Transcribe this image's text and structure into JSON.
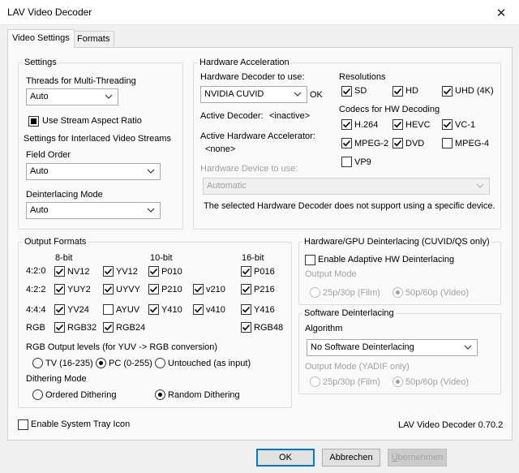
{
  "window": {
    "title": "LAV Video Decoder",
    "close_glyph": "✕"
  },
  "tabs": [
    {
      "label": "Video Settings"
    },
    {
      "label": "Formats"
    }
  ],
  "settings": {
    "legend": "Settings",
    "threads_label": "Threads for Multi-Threading",
    "threads_value": "Auto",
    "stream_aspect_label": "Use Stream Aspect Ratio",
    "interlaced_label": "Settings for Interlaced Video Streams",
    "field_order_label": "Field Order",
    "field_order_value": "Auto",
    "deint_mode_label": "Deinterlacing Mode",
    "deint_mode_value": "Auto"
  },
  "hwaccel": {
    "legend": "Hardware Acceleration",
    "decoder_label": "Hardware Decoder to use:",
    "decoder_value": "NVIDIA CUVID",
    "decoder_status": "OK",
    "active_decoder_label": "Active Decoder:",
    "active_decoder_value": "<inactive>",
    "active_accel_label": "Active Hardware Accelerator:",
    "active_accel_value": "<none>",
    "device_label": "Hardware Device to use:",
    "device_value": "Automatic",
    "note": "The selected Hardware Decoder does not support using a specific device.",
    "resolutions_label": "Resolutions",
    "resolutions": [
      {
        "label": "SD"
      },
      {
        "label": "HD"
      },
      {
        "label": "UHD (4K)"
      }
    ],
    "codecs_label": "Codecs for HW Decoding",
    "codecs": [
      {
        "label": "H.264"
      },
      {
        "label": "HEVC"
      },
      {
        "label": "VC-1"
      },
      {
        "label": "MPEG-2"
      },
      {
        "label": "DVD"
      },
      {
        "label": "MPEG-4"
      },
      {
        "label": "VP9"
      }
    ]
  },
  "output": {
    "legend": "Output Formats",
    "col_8bit": "8-bit",
    "col_10bit": "10-bit",
    "col_16bit": "16-bit",
    "row_420": "4:2:0",
    "row_422": "4:2:2",
    "row_444": "4:4:4",
    "row_rgb": "RGB",
    "fmt": {
      "nv12": "NV12",
      "yv12": "YV12",
      "p010": "P010",
      "p016": "P016",
      "yuy2": "YUY2",
      "uyvy": "UYVY",
      "p210": "P210",
      "v210": "v210",
      "p216": "P216",
      "yv24": "YV24",
      "ayuv": "AYUV",
      "y410": "Y410",
      "v410": "v410",
      "y416": "Y416",
      "rgb32": "RGB32",
      "rgb24": "RGB24",
      "rgb48": "RGB48"
    },
    "levels_label": "RGB Output levels (for YUV -> RGB conversion)",
    "levels": [
      {
        "label": "TV (16-235)"
      },
      {
        "label": "PC (0-255)"
      },
      {
        "label": "Untouched (as input)"
      }
    ],
    "dither_label": "Dithering Mode",
    "dither": [
      {
        "label": "Ordered Dithering"
      },
      {
        "label": "Random Dithering"
      }
    ]
  },
  "hwdeint": {
    "legend": "Hardware/GPU Deinterlacing (CUVID/QS only)",
    "enable_label": "Enable Adaptive HW Deinterlacing",
    "output_mode_label": "Output Mode",
    "opt_film": "25p/30p (Film)",
    "opt_video": "50p/60p (Video)"
  },
  "swdeint": {
    "legend": "Software Deinterlacing",
    "algorithm_label": "Algorithm",
    "algorithm_value": "No Software Deinterlacing",
    "output_mode_label": "Output Mode (YADIF only)",
    "opt_film": "25p/30p (Film)",
    "opt_video": "50p/60p (Video)"
  },
  "tray_label": "Enable System Tray Icon",
  "version": "LAV Video Decoder 0.70.2",
  "buttons": {
    "ok": "OK",
    "cancel": "Abbrechen",
    "apply_prefix": "Ü",
    "apply_rest": "bernehmen"
  }
}
